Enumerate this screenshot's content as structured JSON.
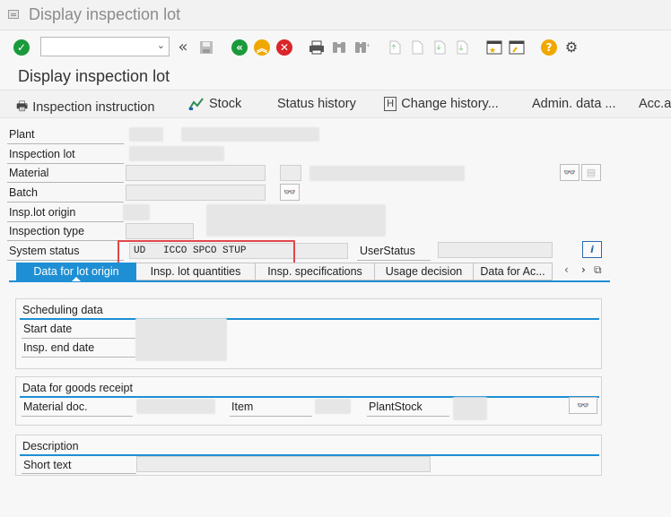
{
  "window": {
    "title": "Display inspection lot"
  },
  "toolbar": {
    "command_value": "",
    "icons": [
      "enter-check-icon",
      "back-double-icon",
      "save-icon",
      "back-icon",
      "exit-icon",
      "cancel-icon",
      "print-icon",
      "find-icon",
      "find-next-icon",
      "first-page-icon",
      "previous-page-icon",
      "next-page-icon",
      "last-page-icon",
      "new-session-icon",
      "shortcut-icon",
      "help-icon",
      "settings-icon"
    ]
  },
  "page": {
    "title": "Display inspection lot"
  },
  "app_toolbar": {
    "inspection_instruction": "Inspection instruction",
    "stock": "Stock",
    "status_history": "Status history",
    "change_history": "Change history...",
    "admin_data": "Admin. data ...",
    "acc": "Acc.a"
  },
  "header": {
    "plant_label": "Plant",
    "inspection_lot_label": "Inspection lot",
    "material_label": "Material",
    "batch_label": "Batch",
    "insp_lot_origin_label": "Insp.lot origin",
    "inspection_type_label": "Inspection type",
    "system_status_label": "System status",
    "system_status_value": "UD   ICCO SPCO STUP",
    "user_status_label": "UserStatus",
    "user_status_value": ""
  },
  "tabs": [
    {
      "label": "Data for lot origin",
      "active": true
    },
    {
      "label": "Insp. lot quantities",
      "active": false
    },
    {
      "label": "Insp. specifications",
      "active": false
    },
    {
      "label": "Usage decision",
      "active": false
    },
    {
      "label": "Data for Ac...",
      "active": false
    }
  ],
  "scheduling": {
    "title": "Scheduling data",
    "start_date_label": "Start date",
    "insp_end_date_label": "Insp. end date"
  },
  "goods_receipt": {
    "title": "Data for goods receipt",
    "material_doc_label": "Material doc.",
    "item_label": "Item",
    "plant_stock_label": "PlantStock"
  },
  "description": {
    "title": "Description",
    "short_text_label": "Short text",
    "short_text_value": ""
  },
  "colors": {
    "accent": "#1e8fd4",
    "highlight": "#e0474c",
    "ok_green": "#1b9a3c",
    "nav_yellow": "#f0a800",
    "cancel_red": "#d9262b"
  }
}
